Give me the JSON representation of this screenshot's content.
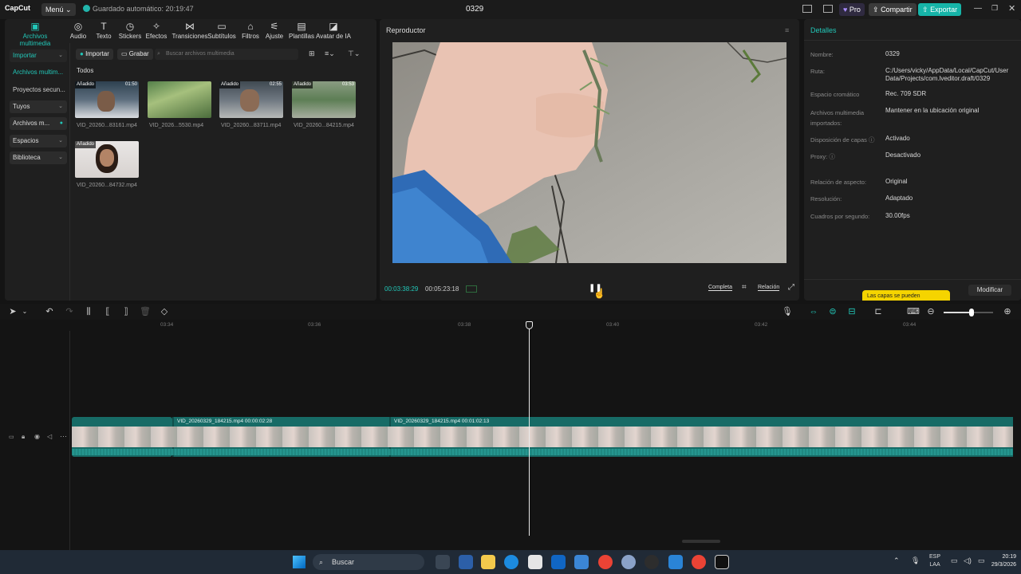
{
  "titlebar": {
    "app": "CapCut",
    "menu": "Menú",
    "autosave": "Guardado automático: 20:19:47",
    "project": "0329",
    "pro": "Pro",
    "share": "Compartir",
    "export": "Exportar"
  },
  "tools": [
    "Archivos multimedia",
    "Audio",
    "Texto",
    "Stickers",
    "Efectos",
    "Transiciones",
    "Subtítulos",
    "Filtros",
    "Ajuste",
    "Plantillas",
    "Avatar de IA"
  ],
  "tool_icons": [
    "▣",
    "◎",
    "T",
    "◷",
    "✧",
    "⋈",
    "▭",
    "⌂",
    "⚟",
    "▤",
    "◪"
  ],
  "leftnav": {
    "import": "Importar",
    "media": "Archivos multim...",
    "projects": "Proyectos secun...",
    "yours": "Tuyos",
    "media2": "Archivos m...",
    "spaces": "Espacios",
    "library": "Biblioteca"
  },
  "media": {
    "import_btn": "Importar",
    "record_btn": "Grabar",
    "search_placeholder": "Buscar archivos multimedia",
    "section": "Todos",
    "items": [
      {
        "name": "VID_20260...83161.mp4",
        "badge": "Añadido",
        "duration": "01:50"
      },
      {
        "name": "VID_2026...5530.mp4",
        "badge": "",
        "duration": ""
      },
      {
        "name": "VID_20260...83711.mp4",
        "badge": "Añadido",
        "duration": "02:55"
      },
      {
        "name": "VID_20260...84215.mp4",
        "badge": "Añadido",
        "duration": "03:53"
      },
      {
        "name": "VID_20260...84732.mp4",
        "badge": "Añadido",
        "duration": ""
      }
    ]
  },
  "player": {
    "title": "Reproductor",
    "current": "00:03:38:29",
    "total": "00:05:23:18",
    "full": "Completa",
    "ratio": "Relación"
  },
  "details": {
    "title": "Detalles",
    "rows": [
      {
        "label": "Nombre:",
        "value": "0329"
      },
      {
        "label": "Ruta:",
        "value": "C:/Users/vicky/AppData/Local/CapCut/User Data/Projects/com.lveditor.draft/0329"
      },
      {
        "label": "Espacio cromático",
        "value": "Rec. 709 SDR"
      },
      {
        "label": "Archivos multimedia importados:",
        "value": "Mantener en la ubicación original"
      },
      {
        "label": "Disposición de capas",
        "value": "Activado"
      },
      {
        "label": "Proxy:",
        "value": "Desactivado"
      },
      {
        "label": "Relación de aspecto:",
        "value": "Original"
      },
      {
        "label": "Resolución:",
        "value": "Adaptado"
      },
      {
        "label": "Cuadros por segundo:",
        "value": "30.00fps"
      }
    ],
    "tooltip": "Las capas se pueden",
    "modify": "Modificar"
  },
  "timeline": {
    "ticks": [
      "03:34",
      "03:36",
      "03:38",
      "03:40",
      "03:42",
      "03:44"
    ],
    "clip1_label": "VID_20260329_184215.mp4  00:00:02:28",
    "clip2_label": "VID_20260329_184215.mp4  00:01:02:13"
  },
  "taskbar": {
    "search": "Buscar",
    "lang1": "ESP",
    "lang2": "LAA",
    "time": "20:19",
    "date": "29/3/2026"
  }
}
